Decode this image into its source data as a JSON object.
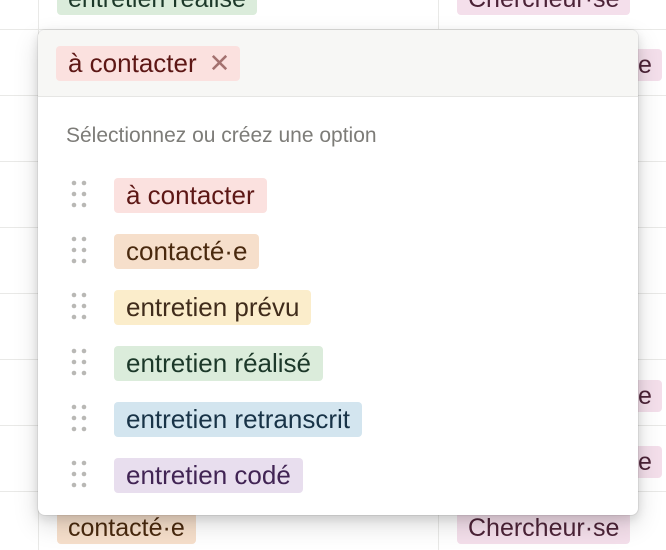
{
  "background": {
    "top_row": {
      "status_tag": "entretien réalisé",
      "role_tag": "Chercheur·se"
    },
    "bottom_row": {
      "status_tag": "contacté·e",
      "role_tag": "Chercheur·se"
    },
    "partial_right_tags": [
      "e",
      "e",
      "e"
    ]
  },
  "popup": {
    "selected": {
      "label": "à contacter",
      "remove_glyph": "✕"
    },
    "section_label": "Sélectionnez ou créez une option",
    "options": [
      {
        "label": "à contacter"
      },
      {
        "label": "contacté·e"
      },
      {
        "label": "entretien prévu"
      },
      {
        "label": "entretien réalisé"
      },
      {
        "label": "entretien retranscrit"
      },
      {
        "label": "entretien codé"
      }
    ]
  },
  "colors": {
    "red_bg": "#fbe1df",
    "red_text": "#5d1715",
    "orange_bg": "#f6dfcb",
    "orange_text": "#49290e",
    "yellow_bg": "#fbedcb",
    "yellow_text": "#402c1b",
    "green_bg": "#dbecdb",
    "green_text": "#1c3829",
    "blue_bg": "#d3e5ef",
    "blue_text": "#183347",
    "purple_bg": "#e8deee",
    "purple_text": "#412454",
    "pink_bg": "#f4dfeb",
    "pink_text": "#4c2337"
  },
  "icons": {
    "drag": "drag-handle-icon",
    "remove": "close-icon"
  }
}
